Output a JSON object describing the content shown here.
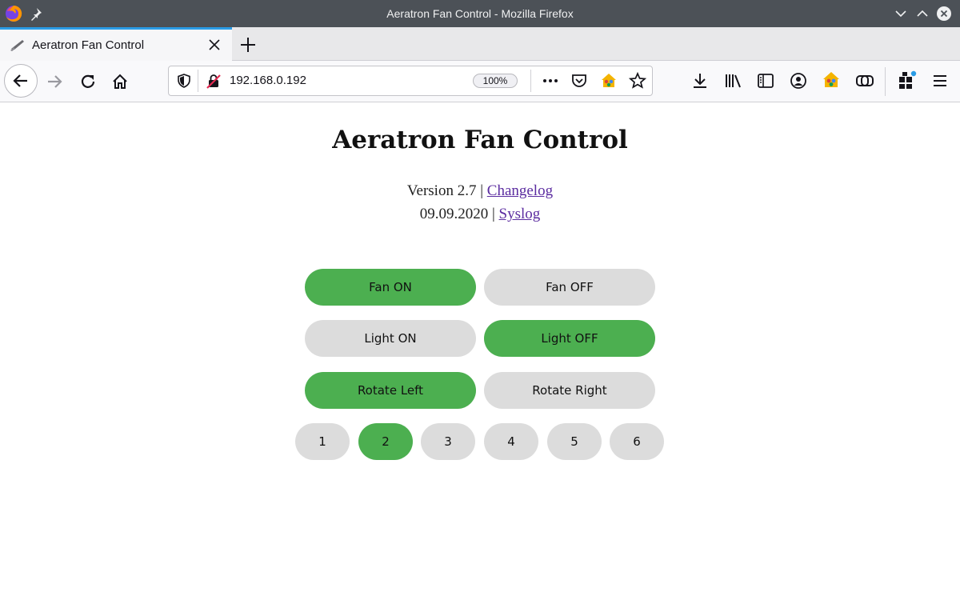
{
  "window": {
    "title": "Aeratron Fan Control - Mozilla Firefox"
  },
  "tab": {
    "title": "Aeratron Fan Control"
  },
  "navbar": {
    "url": "192.168.0.192",
    "zoom": "100%"
  },
  "page": {
    "title": "Aeratron Fan Control",
    "version_text": "Version 2.7 |",
    "changelog_link": "Changelog",
    "date_text": "09.09.2020 |",
    "syslog_link": "Syslog"
  },
  "controls": {
    "fan_on": "Fan ON",
    "fan_off": "Fan OFF",
    "light_on": "Light ON",
    "light_off": "Light OFF",
    "rotate_left": "Rotate Left",
    "rotate_right": "Rotate Right",
    "speeds": [
      "1",
      "2",
      "3",
      "4",
      "5",
      "6"
    ],
    "active_speed": "2",
    "active_states": [
      "Fan ON",
      "Light OFF",
      "Rotate Left"
    ]
  },
  "colors": {
    "active_button": "#4caf50",
    "inactive_button": "#dcdcdc",
    "link": "#5b2ca0",
    "titlebar": "#4c5157",
    "tab_accent": "#2a9ce6"
  }
}
